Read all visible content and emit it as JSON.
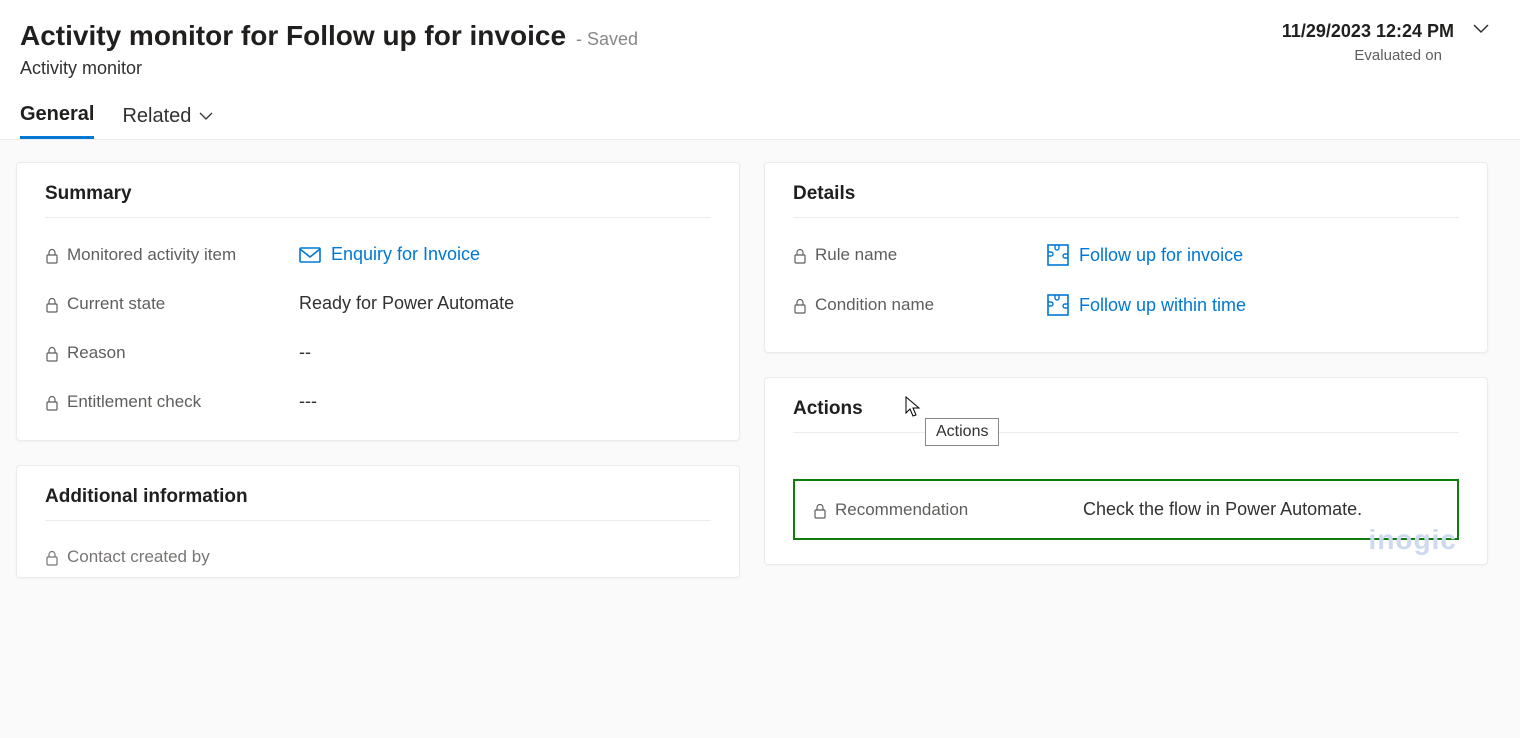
{
  "header": {
    "title": "Activity monitor for Follow up for invoice",
    "save_state": "- Saved",
    "subtitle": "Activity monitor",
    "timestamp": "11/29/2023 12:24 PM",
    "evaluated_label": "Evaluated on"
  },
  "tabs": {
    "general": "General",
    "related": "Related"
  },
  "summary": {
    "title": "Summary",
    "monitored_label": "Monitored activity item",
    "monitored_value": "Enquiry for Invoice",
    "state_label": "Current state",
    "state_value": "Ready for Power Automate",
    "reason_label": "Reason",
    "reason_value": "--",
    "entitlement_label": "Entitlement check",
    "entitlement_value": "---"
  },
  "additional": {
    "title": "Additional information",
    "contact_label": "Contact created by"
  },
  "details": {
    "title": "Details",
    "rule_label": "Rule name",
    "rule_value": "Follow up for invoice",
    "condition_label": "Condition name",
    "condition_value": "Follow up within time"
  },
  "actions": {
    "title": "Actions",
    "tooltip": "Actions",
    "recommendation_label": "Recommendation",
    "recommendation_value": "Check the flow in Power Automate."
  },
  "watermark": "inogic"
}
